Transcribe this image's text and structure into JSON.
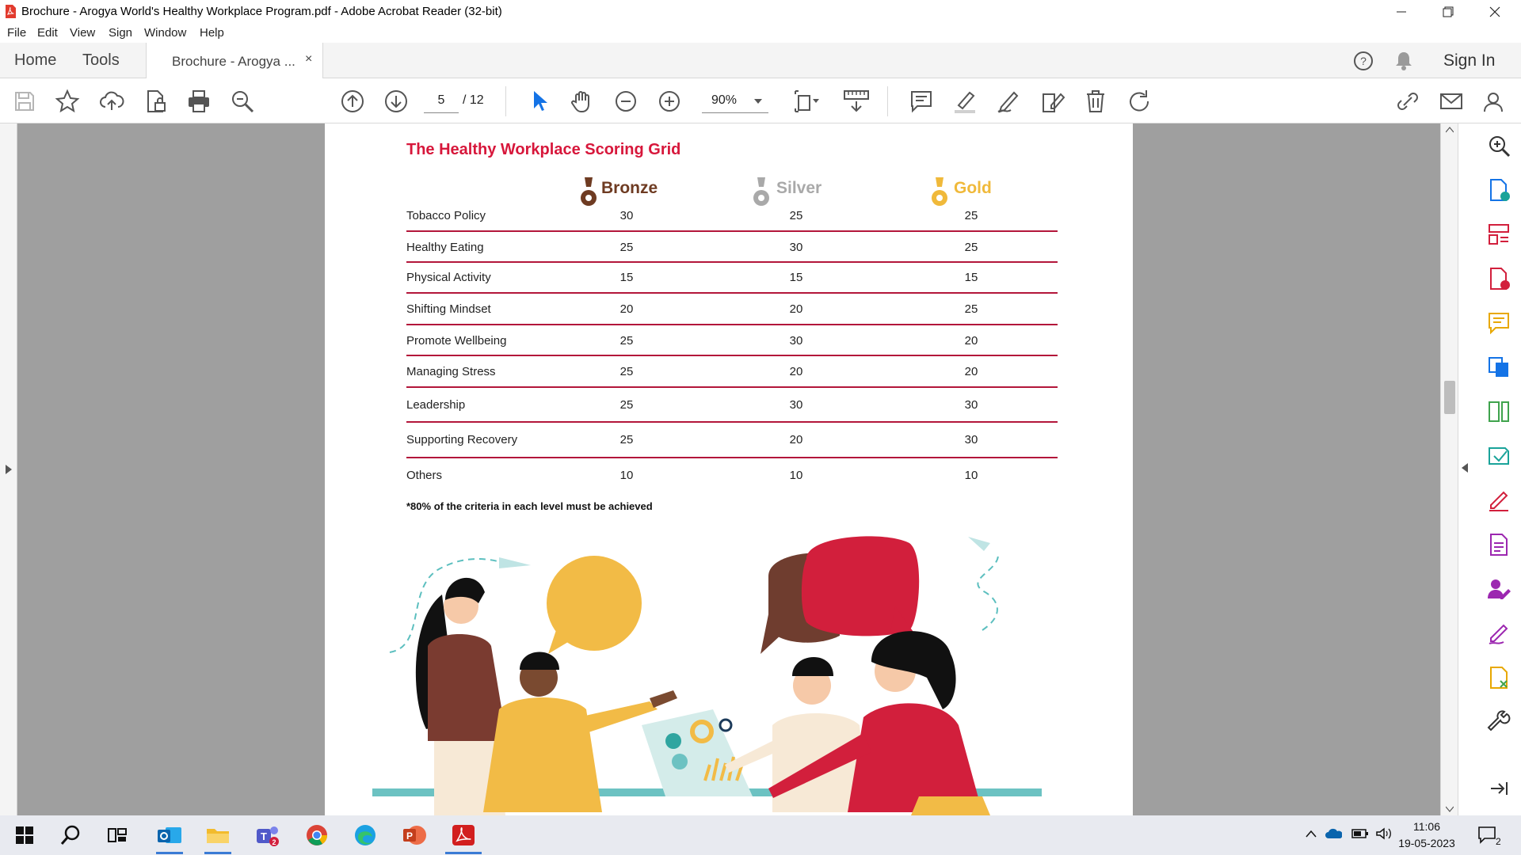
{
  "window": {
    "title": "Brochure - Arogya World's Healthy Workplace Program.pdf - Adobe Acrobat Reader (32-bit)"
  },
  "menu": [
    "File",
    "Edit",
    "View",
    "Sign",
    "Window",
    "Help"
  ],
  "tabs": {
    "home": "Home",
    "tools": "Tools",
    "document": "Brochure - Arogya ...",
    "close": "×",
    "sign_in": "Sign In"
  },
  "toolbar": {
    "page_current": "5",
    "page_total": "/ 12",
    "zoom": "90%"
  },
  "document": {
    "title": "The Healthy Workplace Scoring Grid",
    "levels": [
      "Bronze",
      "Silver",
      "Gold"
    ],
    "level_colors": [
      "#6e3b22",
      "#a9a9a9",
      "#f0b93a"
    ],
    "rows": [
      {
        "label": "Tobacco Policy",
        "values": [
          "30",
          "25",
          "25"
        ]
      },
      {
        "label": "Healthy Eating",
        "values": [
          "25",
          "30",
          "25"
        ]
      },
      {
        "label": "Physical Activity",
        "values": [
          "15",
          "15",
          "15"
        ]
      },
      {
        "label": "Shifting Mindset",
        "values": [
          "20",
          "20",
          "25"
        ]
      },
      {
        "label": "Promote Wellbeing",
        "values": [
          "25",
          "30",
          "20"
        ]
      },
      {
        "label": "Managing Stress",
        "values": [
          "25",
          "20",
          "20"
        ]
      },
      {
        "label": "Leadership",
        "values": [
          "25",
          "30",
          "30"
        ]
      },
      {
        "label": "Supporting Recovery",
        "values": [
          "25",
          "20",
          "30"
        ]
      },
      {
        "label": "Others",
        "values": [
          "10",
          "10",
          "10"
        ]
      }
    ],
    "footnote": "*80% of the criteria in each level must be achieved"
  },
  "taskbar": {
    "time": "11:06",
    "date": "19-05-2023",
    "notification_count": "2"
  },
  "colors": {
    "accent_red": "#d7173b",
    "rule_red": "#b3163a",
    "taskbar_accent": "#3a7bd5"
  }
}
